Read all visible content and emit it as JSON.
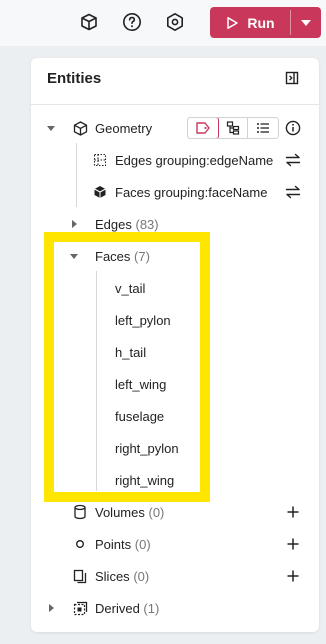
{
  "topbar": {
    "icons": [
      "cube-icon",
      "help-icon",
      "settings-hex-icon"
    ],
    "run_label": "Run",
    "run_color": "#c9385a"
  },
  "panel": {
    "title": "Entities"
  },
  "tree": {
    "geometry": {
      "label": "Geometry"
    },
    "edges_grouping": {
      "label": "Edges grouping:edgeName"
    },
    "faces_grouping": {
      "label": "Faces grouping:faceName"
    },
    "edges": {
      "label": "Edges",
      "count": "(83)"
    },
    "faces": {
      "label": "Faces",
      "count": "(7)"
    },
    "face_items": [
      "v_tail",
      "left_pylon",
      "h_tail",
      "left_wing",
      "fuselage",
      "right_pylon",
      "right_wing"
    ],
    "volumes": {
      "label": "Volumes",
      "count": "(0)"
    },
    "points": {
      "label": "Points",
      "count": "(0)"
    },
    "slices": {
      "label": "Slices",
      "count": "(0)"
    },
    "derived": {
      "label": "Derived",
      "count": "(1)"
    }
  },
  "highlight_color": "#ffe600"
}
